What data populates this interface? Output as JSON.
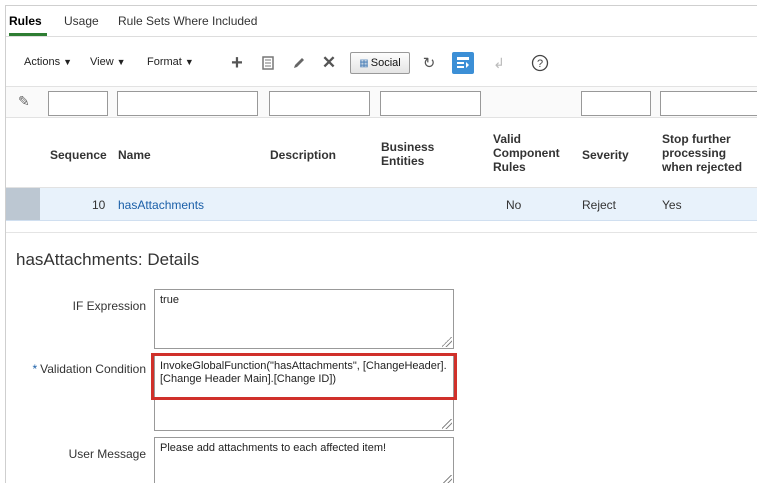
{
  "tabs": [
    {
      "label": "Rules",
      "active": true
    },
    {
      "label": "Usage",
      "active": false
    },
    {
      "label": "Rule Sets Where Included",
      "active": false
    }
  ],
  "toolbar": {
    "actions": "Actions",
    "view": "View",
    "format": "Format",
    "social": "Social",
    "icons": [
      "add-icon",
      "delete-icon",
      "edit-icon",
      "close-icon",
      "refresh-icon",
      "freeze-icon",
      "wrap-icon",
      "help-icon"
    ]
  },
  "table": {
    "columns": {
      "sequence": "Sequence",
      "name": "Name",
      "description": "Description",
      "business_entities": "Business Entities",
      "valid_component_rules": "Valid Component Rules",
      "severity": "Severity",
      "stop_processing": "Stop further processing when rejected"
    },
    "rows": [
      {
        "sequence": "10",
        "name": "hasAttachments",
        "description": "",
        "business_entities": "",
        "valid_component_rules": "No",
        "severity": "Reject",
        "stop_processing": "Yes"
      }
    ]
  },
  "details": {
    "title": "hasAttachments: Details",
    "if_expression_label": "IF Expression",
    "if_expression_value": "true",
    "validation_label": "Validation Condition",
    "validation_required_marker": "*",
    "validation_value": "InvokeGlobalFunction(\"hasAttachments\", [ChangeHeader].[Change Header Main].[Change ID])",
    "user_message_label": "User Message",
    "user_message_value": "Please add attachments to each affected item!"
  },
  "colors": {
    "accent_green": "#2e7d32",
    "link_blue": "#1a5fa8",
    "highlight_red": "#d0302a",
    "selected_row": "#e8f2fb"
  }
}
